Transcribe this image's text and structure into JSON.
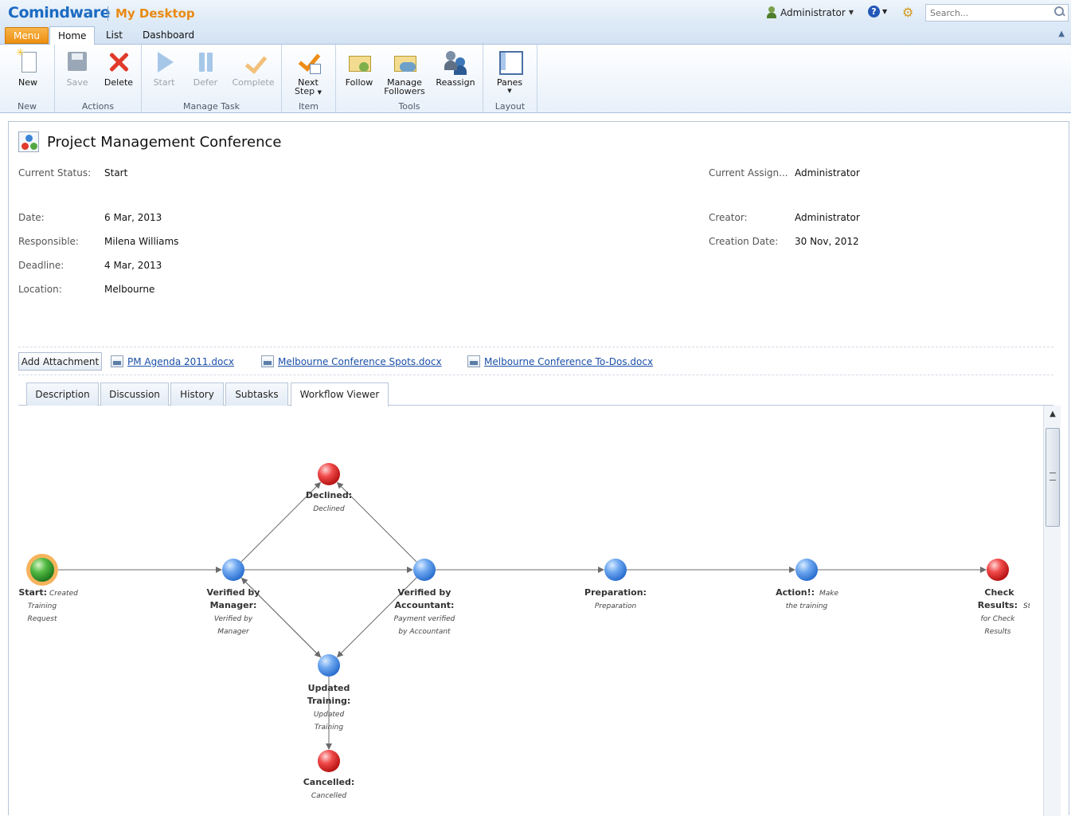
{
  "header": {
    "brand": "Comindware",
    "app_title": "My Desktop",
    "user": "Administrator",
    "help": "?",
    "search_placeholder": "Search..."
  },
  "ribbon_tabs": {
    "menu": "Menu",
    "home": "Home",
    "list": "List",
    "dashboard": "Dashboard"
  },
  "ribbon": {
    "groups": {
      "new": "New",
      "actions": "Actions",
      "manage_task": "Manage Task",
      "item": "Item",
      "tools": "Tools",
      "layout": "Layout"
    },
    "buttons": {
      "new": "New",
      "save": "Save",
      "delete": "Delete",
      "start": "Start",
      "defer": "Defer",
      "complete": "Complete",
      "next_step_1": "Next",
      "next_step_2": "Step",
      "follow": "Follow",
      "manage_followers_1": "Manage",
      "manage_followers_2": "Followers",
      "reassign": "Reassign",
      "panes": "Panes"
    }
  },
  "task": {
    "title": "Project Management Conference",
    "fields_left": [
      {
        "label": "Current Status:",
        "value": "Start"
      },
      {
        "label": "Date:",
        "value": "6 Mar, 2013"
      },
      {
        "label": "Responsible:",
        "value": "Milena Williams"
      },
      {
        "label": "Deadline:",
        "value": "4 Mar, 2013"
      },
      {
        "label": "Location:",
        "value": "Melbourne"
      }
    ],
    "fields_right": [
      {
        "label": "Current Assign...",
        "value": "Administrator"
      },
      {
        "label": "Creator:",
        "value": "Administrator"
      },
      {
        "label": "Creation Date:",
        "value": "30 Nov, 2012"
      }
    ]
  },
  "attachments": {
    "add_button": "Add Attachment",
    "files": [
      "PM Agenda 2011.docx",
      "Melbourne Conference Spots.docx",
      "Melbourne Conference To-Dos.docx"
    ]
  },
  "detail_tabs": [
    "Description",
    "Discussion",
    "History",
    "Subtasks",
    "Workflow Viewer"
  ],
  "workflow": {
    "colors": {
      "start": "#3fa83a",
      "step": "#4d90e6",
      "end": "#e22a2a",
      "edge": "#6b6b6b"
    },
    "nodes": [
      {
        "id": "start",
        "kind": "start",
        "title": "Start:",
        "lines": [
          "Created",
          "Training",
          "Request"
        ]
      },
      {
        "id": "vm",
        "kind": "step",
        "title": "Verified by Manager:",
        "lines": [
          "Verified by",
          "Manager"
        ]
      },
      {
        "id": "declined",
        "kind": "end",
        "title": "Declined:",
        "lines": [
          "Declined"
        ]
      },
      {
        "id": "va",
        "kind": "step",
        "title": "Verified by Accountant:",
        "lines": [
          "Payment verified",
          "by Accountant"
        ]
      },
      {
        "id": "upd",
        "kind": "step",
        "title": "Updated Training:",
        "lines": [
          "Updated",
          "Training"
        ]
      },
      {
        "id": "canc",
        "kind": "end",
        "title": "Cancelled:",
        "lines": [
          "Cancelled"
        ]
      },
      {
        "id": "prep",
        "kind": "step",
        "title": "Preparation:",
        "lines": [
          "Preparation"
        ]
      },
      {
        "id": "act",
        "kind": "step",
        "title": "Action!:",
        "lines": [
          "Make",
          "the training"
        ]
      },
      {
        "id": "check",
        "kind": "end",
        "title": "Check Results:",
        "lines": [
          "Step",
          "for Check",
          "Results"
        ]
      }
    ],
    "edges": [
      [
        "start",
        "vm"
      ],
      [
        "vm",
        "va"
      ],
      [
        "vm",
        "declined"
      ],
      [
        "va",
        "declined"
      ],
      [
        "vm",
        "upd"
      ],
      [
        "upd",
        "vm"
      ],
      [
        "va",
        "upd"
      ],
      [
        "upd",
        "canc"
      ],
      [
        "va",
        "prep"
      ],
      [
        "prep",
        "act"
      ],
      [
        "act",
        "check"
      ]
    ]
  }
}
